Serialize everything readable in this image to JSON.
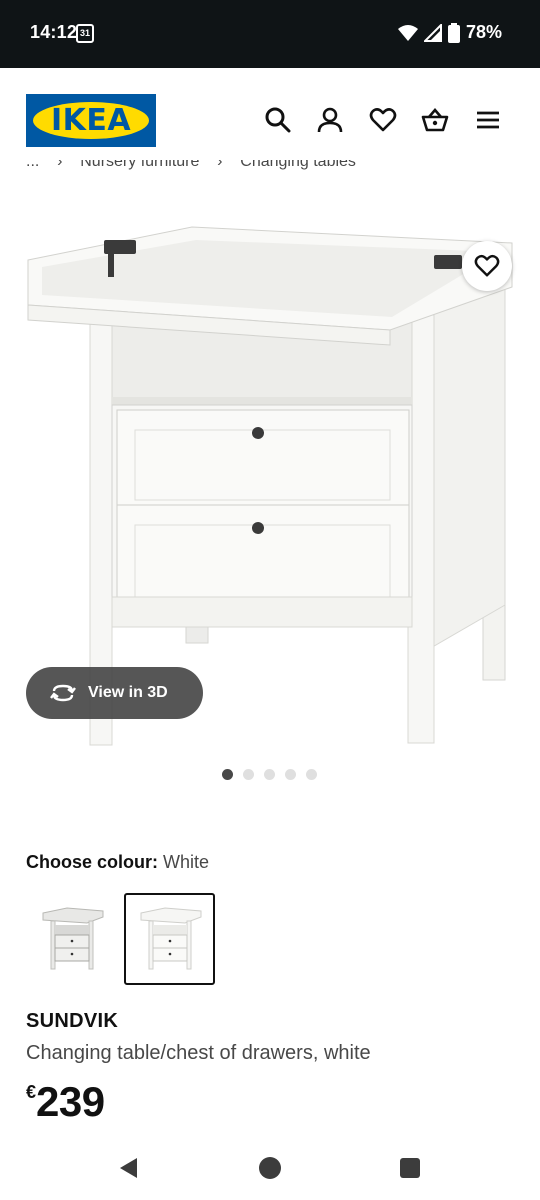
{
  "status_bar": {
    "time": "14:12",
    "calendar_day": "31",
    "battery": "78%"
  },
  "header": {
    "logo_text": "IKEA",
    "brand_colors": {
      "blue": "#0058a3",
      "yellow": "#ffdb00"
    },
    "icons": [
      "search-icon",
      "account-icon",
      "heart-icon",
      "basket-icon",
      "menu-icon"
    ]
  },
  "breadcrumb": {
    "items": [
      "...",
      "Nursery furniture",
      "Changing tables"
    ],
    "separator": "›"
  },
  "gallery": {
    "view_3d_label": "View in 3D",
    "image_count": 5,
    "active_index": 0
  },
  "colour": {
    "label": "Choose colour:",
    "value": "White",
    "options": [
      "grey-white",
      "white"
    ],
    "selected_index": 1
  },
  "product": {
    "name": "SUNDVIK",
    "description": "Changing table/chest of drawers, white",
    "currency": "€",
    "price": "239"
  }
}
